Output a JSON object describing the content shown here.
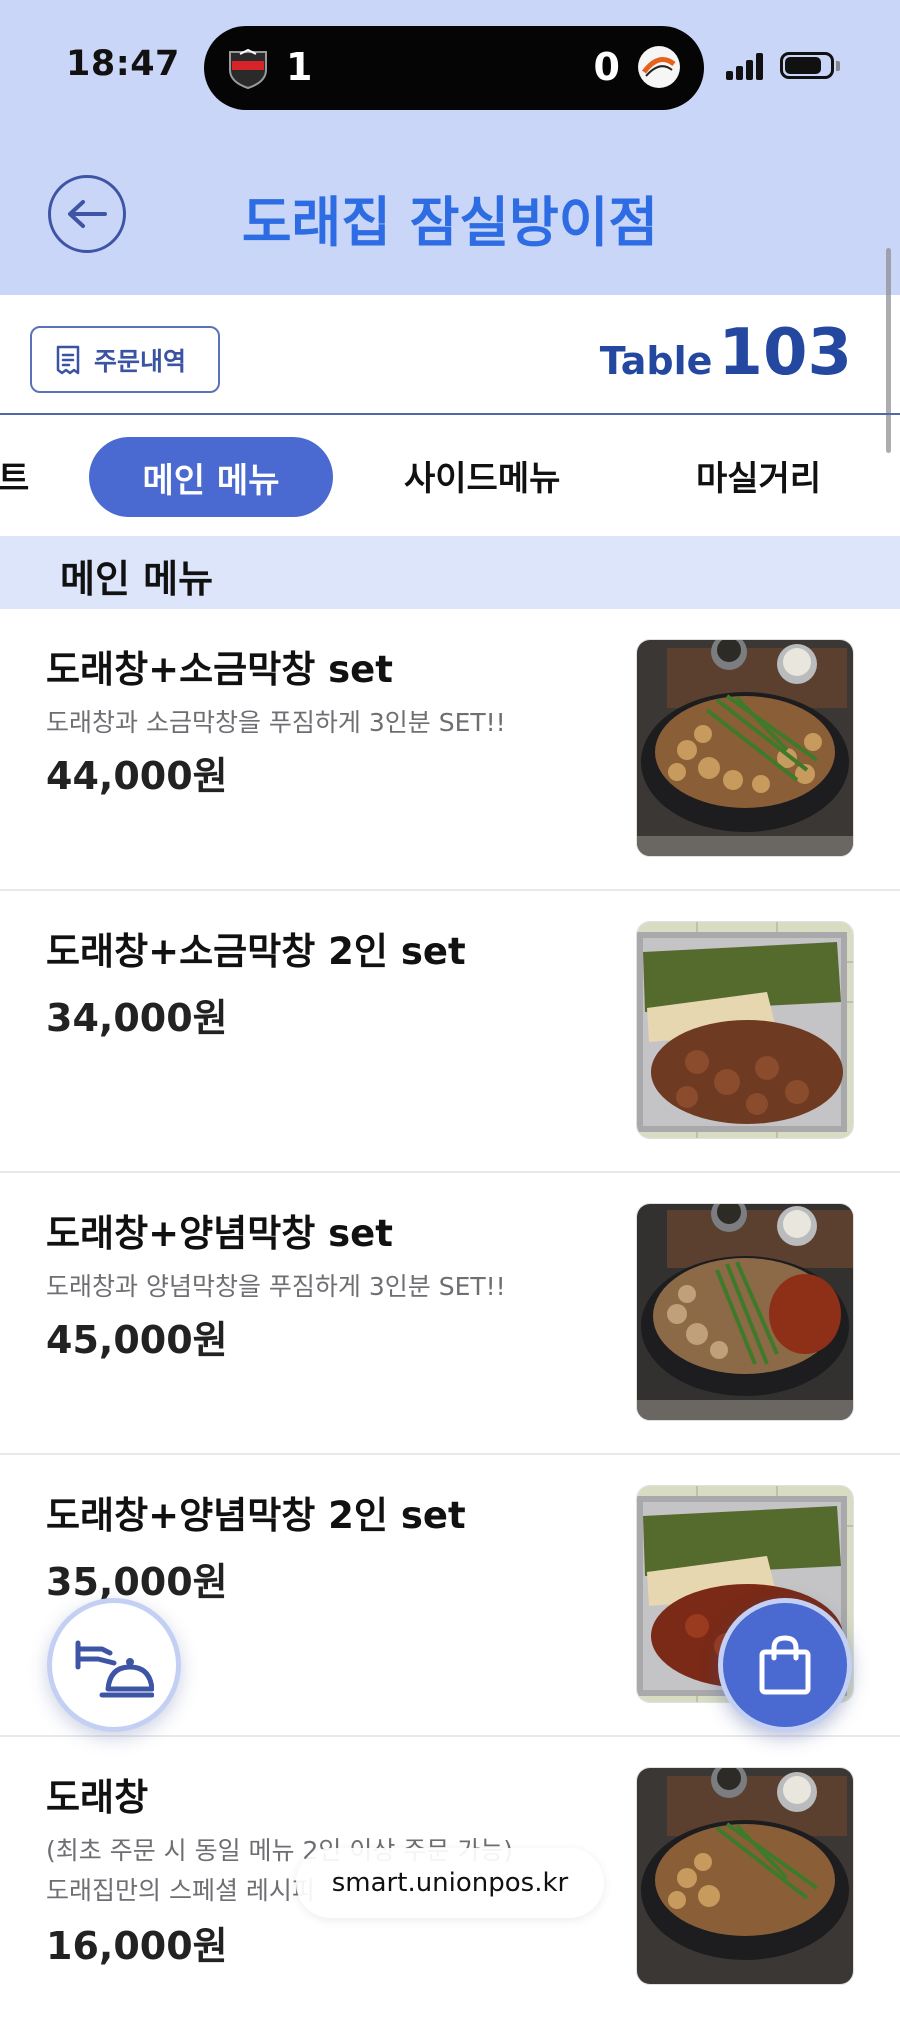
{
  "status_bar": {
    "time": "18:47",
    "score_left": "1",
    "score_right": "0"
  },
  "header": {
    "title": "도래집 잠실방이점"
  },
  "toolbar": {
    "order_history_label": "주문내역",
    "table_prefix": "Table",
    "table_number": "103"
  },
  "tabs": [
    {
      "label": "트",
      "active": false
    },
    {
      "label": "메인 메뉴",
      "active": true
    },
    {
      "label": "사이드메뉴",
      "active": false
    },
    {
      "label": "마실거리",
      "active": false
    }
  ],
  "section": {
    "title": "메인 메뉴"
  },
  "menu_items": [
    {
      "name": "도래창+소금막창 set",
      "description": "도래창과 소금막창을 푸짐하게 3인분 SET!!",
      "price": "44,000원"
    },
    {
      "name": "도래창+소금막창 2인 set",
      "description": "",
      "price": "34,000원"
    },
    {
      "name": "도래창+양념막창 set",
      "description": "도래창과 양념막창을 푸짐하게 3인분 SET!!",
      "price": "45,000원"
    },
    {
      "name": "도래창+양념막창 2인 set",
      "description": "",
      "price": "35,000원"
    },
    {
      "name": "도래창",
      "description": "(최초 주문 시 동일 메뉴 2인 이상 주문 가능)",
      "description2": "도래집만의 스페셜 레시피",
      "price": "16,000원"
    }
  ],
  "browser": {
    "url": "smart.unionpos.kr"
  },
  "colors": {
    "header_bg": "#c9d6f8",
    "title_blue": "#2d6ce2",
    "accent": "#4a6ad1",
    "section_bg": "#dde5fb"
  },
  "icons": [
    "back-arrow-icon",
    "receipt-icon",
    "serving-bell-icon",
    "shopping-bag-icon"
  ]
}
